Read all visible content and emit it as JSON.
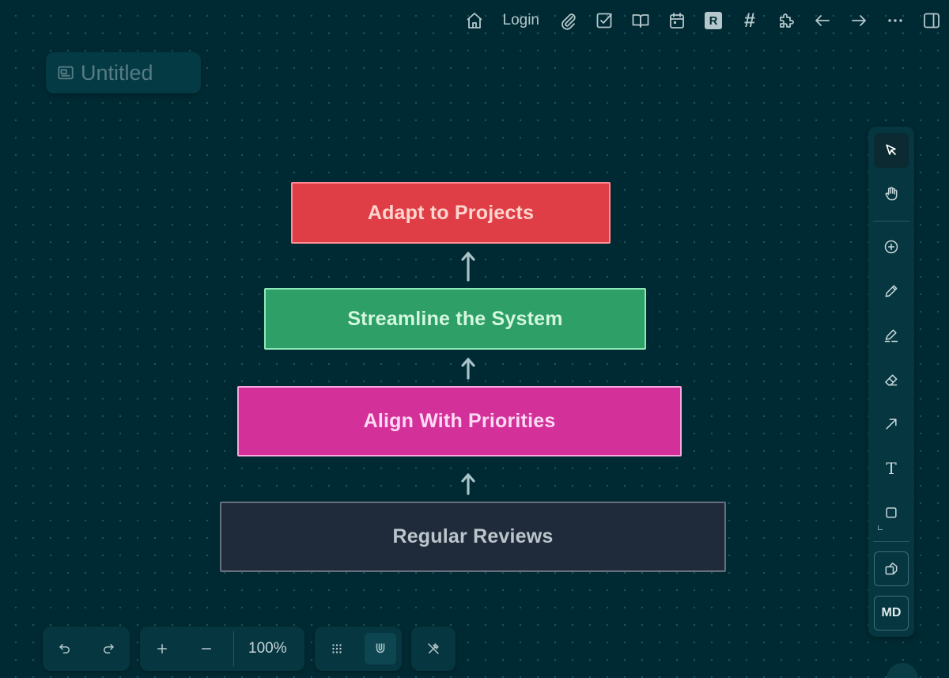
{
  "topbar": {
    "login_label": "Login",
    "r_label": "R",
    "hash_label": "#",
    "icons": [
      "home-icon",
      "attachment-icon",
      "checkbox-icon",
      "book-icon",
      "calendar-icon",
      "r-icon",
      "hash-icon",
      "puzzle-icon",
      "arrow-left-icon",
      "arrow-right-icon",
      "more-icon",
      "sidebar-toggle-icon"
    ]
  },
  "document": {
    "title": "Untitled"
  },
  "diagram": {
    "boxes": [
      {
        "label": "Adapt to Projects",
        "color": "#e03e46"
      },
      {
        "label": "Streamline the System",
        "color": "#2e9f66"
      },
      {
        "label": "Align With Priorities",
        "color": "#d3309a"
      },
      {
        "label": "Regular Reviews",
        "color": "#1f2b3a"
      }
    ],
    "arrow_color": "#a9c3c7"
  },
  "tools": {
    "items": [
      "select-tool",
      "hand-tool",
      "add-tool",
      "pen-tool",
      "highlighter-tool",
      "eraser-tool",
      "arrow-tool",
      "text-tool",
      "rectangle-tool",
      "shapes-tool",
      "markdown-tool"
    ],
    "text_tool_label": "T",
    "md_label": "MD",
    "active": "select-tool"
  },
  "bottombar": {
    "zoom_level": "100%"
  },
  "colors": {
    "canvas_bg": "#002a33",
    "panel_bg": "#063640"
  }
}
